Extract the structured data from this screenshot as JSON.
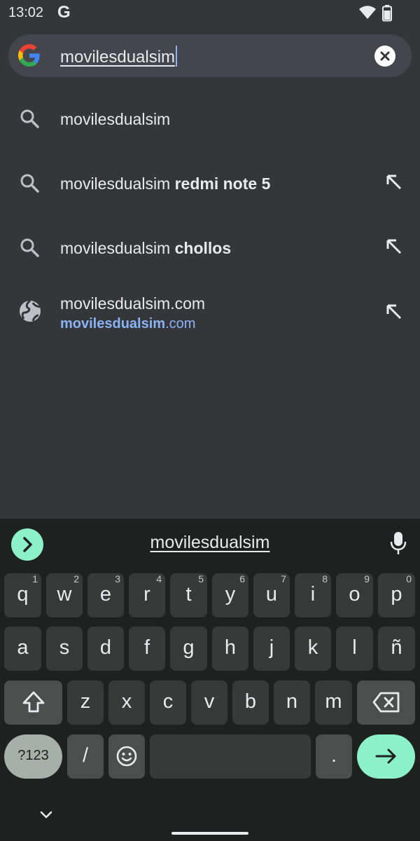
{
  "status": {
    "time": "13:02",
    "notif_icon": "G"
  },
  "omnibox": {
    "query": "movilesdualsim"
  },
  "suggestions": [
    {
      "type": "search",
      "plain": "movilesdualsim",
      "bold": ""
    },
    {
      "type": "search",
      "plain": "movilesdualsim ",
      "bold": "redmi note 5"
    },
    {
      "type": "search",
      "plain": "movilesdualsim ",
      "bold": "chollos"
    },
    {
      "type": "site",
      "plain": "movilesdualsim.com",
      "url_bold": "movilesdualsim",
      "url_rest": ".com"
    }
  ],
  "keyboard": {
    "suggestion": "movilesdualsim",
    "row1": [
      {
        "k": "q",
        "h": "1"
      },
      {
        "k": "w",
        "h": "2"
      },
      {
        "k": "e",
        "h": "3"
      },
      {
        "k": "r",
        "h": "4"
      },
      {
        "k": "t",
        "h": "5"
      },
      {
        "k": "y",
        "h": "6"
      },
      {
        "k": "u",
        "h": "7"
      },
      {
        "k": "i",
        "h": "8"
      },
      {
        "k": "o",
        "h": "9"
      },
      {
        "k": "p",
        "h": "0"
      }
    ],
    "row2": [
      "a",
      "s",
      "d",
      "f",
      "g",
      "h",
      "j",
      "k",
      "l",
      "ñ"
    ],
    "row3": [
      "z",
      "x",
      "c",
      "v",
      "b",
      "n",
      "m"
    ],
    "symbols_label": "?123",
    "slash": "/",
    "period": "."
  },
  "colors": {
    "accent_link": "#8ab4f8",
    "keyboard_accent": "#8cf0c8"
  }
}
